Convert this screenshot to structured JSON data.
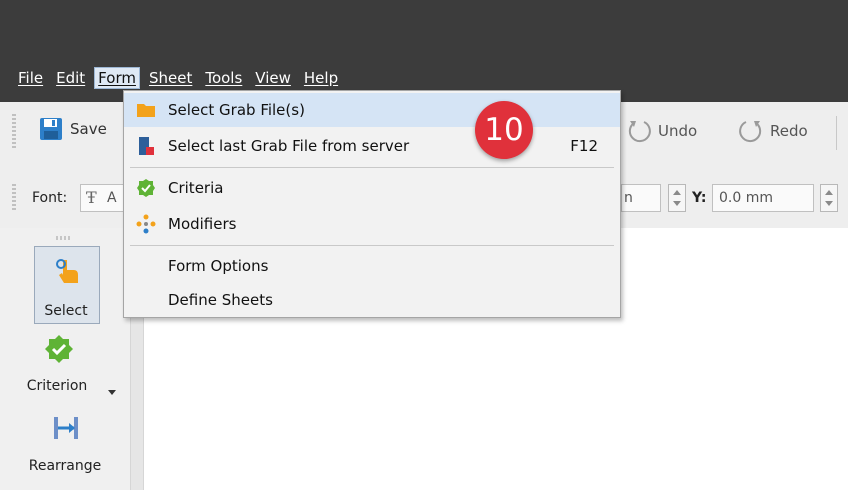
{
  "menubar": {
    "items": [
      {
        "label": "File"
      },
      {
        "label": "Edit"
      },
      {
        "label": "Form"
      },
      {
        "label": "Sheet"
      },
      {
        "label": "Tools"
      },
      {
        "label": "View"
      },
      {
        "label": "Help"
      }
    ],
    "active_menu": "Form"
  },
  "toolbar": {
    "save_label": "Save",
    "undo_label": "Undo",
    "redo_label": "Redo"
  },
  "fontbar": {
    "font_label": "Font:",
    "font_value_partial": "A",
    "x_value_partial": "n",
    "y_label": "Y:",
    "y_value": "0.0 mm"
  },
  "sidebar": {
    "select_label": "Select",
    "criterion_label": "Criterion",
    "rearrange_label": "Rearrange"
  },
  "form_menu": {
    "items": [
      {
        "label": "Select Grab File(s)",
        "icon": "folder-icon",
        "highlighted": true
      },
      {
        "label": "Select last Grab File from server",
        "icon": "server-file-icon",
        "shortcut": "F12"
      },
      {
        "label": "Criteria",
        "icon": "green-check-badge-icon"
      },
      {
        "label": "Modifiers",
        "icon": "modifiers-dots-icon"
      },
      {
        "label": "Form Options"
      },
      {
        "label": "Define Sheets"
      }
    ]
  },
  "step_badge": {
    "number": "10",
    "color": "#e0313b"
  },
  "colors": {
    "titlebar": "#3c3c3c",
    "menu_highlight": "#d5e4f5",
    "accent_green": "#5fb336",
    "accent_orange": "#f3a21b",
    "accent_blue": "#2d7fc9"
  }
}
